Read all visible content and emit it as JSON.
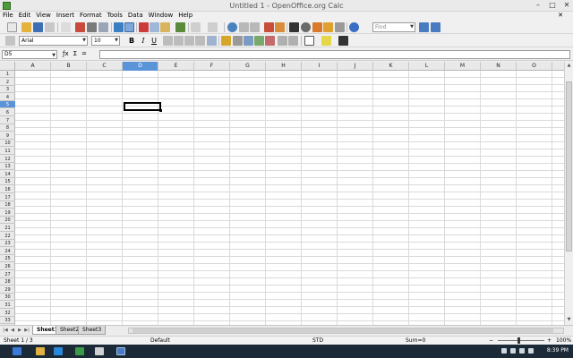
{
  "window": {
    "title": "Untitled 1 - OpenOffice.org Calc",
    "minimize": "–",
    "maximize": "□",
    "close": "✕"
  },
  "menu": {
    "items": [
      "File",
      "Edit",
      "View",
      "Insert",
      "Format",
      "Tools",
      "Data",
      "Window",
      "Help"
    ],
    "close_doc": "✕"
  },
  "toolbar": {
    "find_placeholder": "Find"
  },
  "format_toolbar": {
    "font": "Arial",
    "size": "10",
    "bold": "B",
    "italic": "I",
    "underline": "U"
  },
  "formula_bar": {
    "cell_ref": "D5",
    "fx": "ƒx",
    "sum": "Σ",
    "equals": "=",
    "content": ""
  },
  "grid": {
    "columns": [
      "A",
      "B",
      "C",
      "D",
      "E",
      "F",
      "G",
      "H",
      "I",
      "J",
      "K",
      "L",
      "M",
      "N",
      "O"
    ],
    "rows": [
      "1",
      "2",
      "3",
      "4",
      "5",
      "6",
      "7",
      "8",
      "9",
      "10",
      "11",
      "12",
      "13",
      "14",
      "15",
      "16",
      "17",
      "18",
      "19",
      "20",
      "21",
      "22",
      "23",
      "24",
      "25",
      "26",
      "27",
      "28",
      "29",
      "30",
      "31",
      "32",
      "33"
    ],
    "selected_column": "D",
    "selected_row": "5"
  },
  "sheets": {
    "tabs": [
      "Sheet1",
      "Sheet2",
      "Sheet3"
    ],
    "active": "Sheet1"
  },
  "status": {
    "sheet": "Sheet 1 / 3",
    "style": "Default",
    "mode": "STD",
    "sum": "Sum=0",
    "zoom": "100%"
  },
  "taskbar": {
    "clock": "8:39 PM"
  },
  "colors": {
    "selection": "#5a94d8",
    "taskbar": "#1c2a38"
  }
}
